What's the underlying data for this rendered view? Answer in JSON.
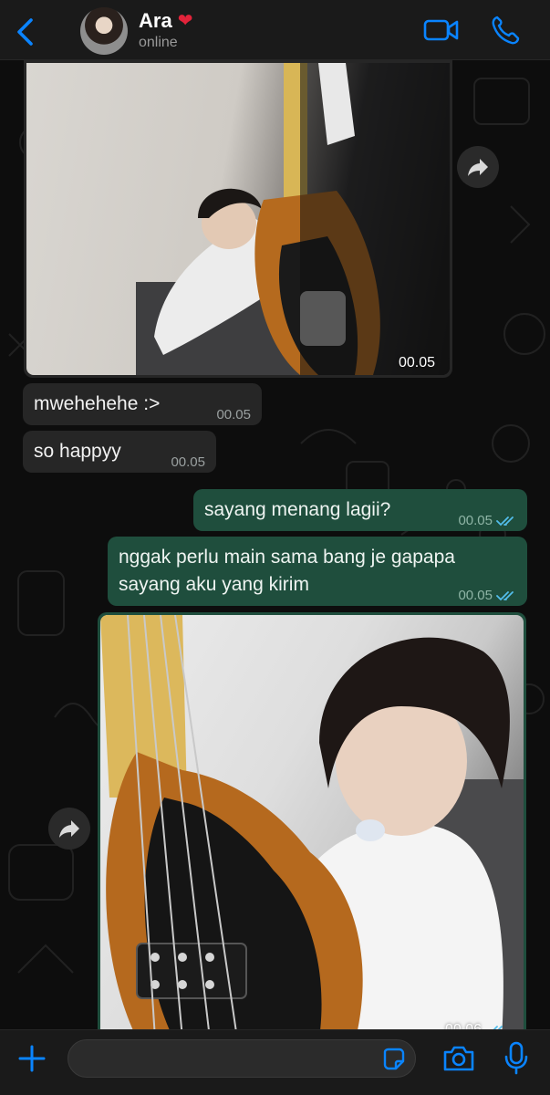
{
  "header": {
    "name": "Ara",
    "heart": "❤️",
    "status": "online",
    "icons": [
      "back-chevron-icon",
      "video-call-icon",
      "phone-call-icon"
    ],
    "accent": "#0a84ff"
  },
  "messages": [
    {
      "type": "image",
      "direction": "incoming",
      "time": "00.05",
      "alt_subject": "selfie with bass guitar"
    },
    {
      "type": "text",
      "direction": "incoming",
      "text": "mwehehehe :>",
      "time": "00.05"
    },
    {
      "type": "text",
      "direction": "incoming",
      "text": "so happyy",
      "time": "00.05"
    },
    {
      "type": "text",
      "direction": "outgoing",
      "text": "sayang menang lagii?",
      "time": "00.05",
      "read": true
    },
    {
      "type": "text",
      "direction": "outgoing",
      "text_line1": "nggak perlu main sama bang je gapapa",
      "text_line2": "sayang aku yang kirim",
      "time": "00.05",
      "read": true
    },
    {
      "type": "image",
      "direction": "outgoing",
      "time": "00.06",
      "read": true,
      "alt_subject": "selfie with bass guitar and pick"
    }
  ],
  "composer": {
    "placeholder": "",
    "icons": [
      "plus-icon",
      "sticker-icon",
      "camera-icon",
      "mic-icon"
    ]
  },
  "colors": {
    "incoming_bubble": "#262626",
    "outgoing_bubble": "#1f4e3d",
    "read_ticks": "#53bdeb"
  }
}
